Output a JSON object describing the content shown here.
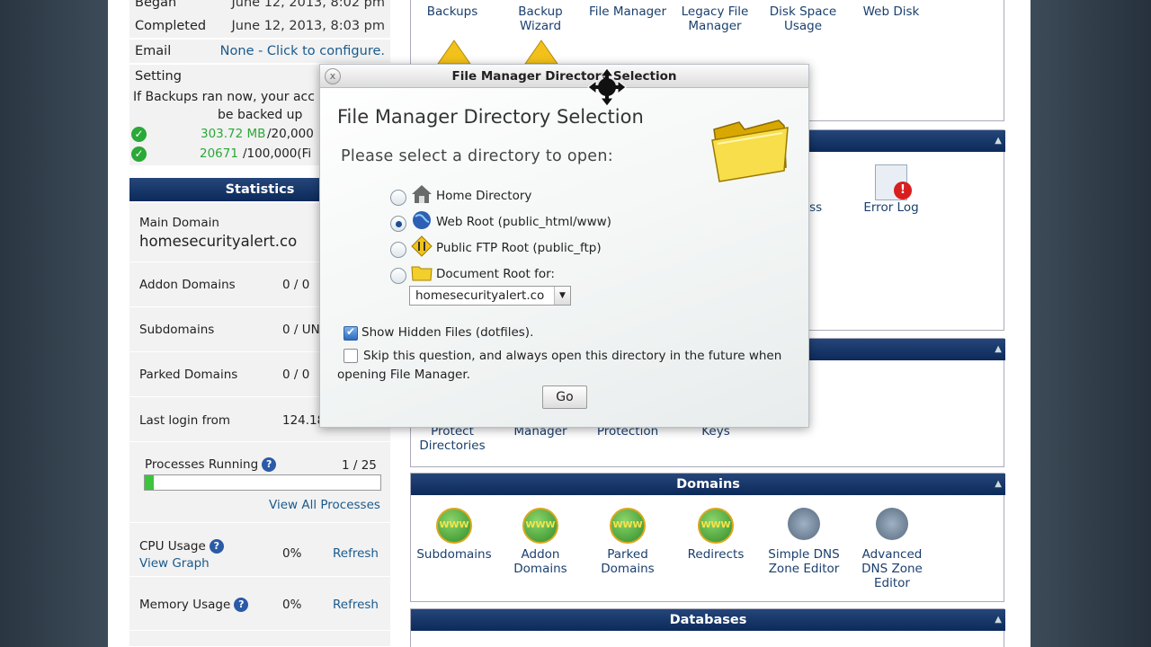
{
  "backup": {
    "began_label": "Began",
    "began_value": "June 12, 2013, 8:02 pm",
    "completed_label": "Completed",
    "completed_value": "June 12, 2013, 8:03 pm",
    "email_label": "Email",
    "email_value": "None - Click to configure.",
    "setting_label": "Setting",
    "message_line1": "If Backups ran now, your acc",
    "message_line2": "be backed up",
    "size_value": "303.72 MB",
    "size_limit": "/20,000",
    "files_value": "20671",
    "files_limit": "/100,000(Fi"
  },
  "stats": {
    "title": "Statistics",
    "main_domain_label": "Main Domain",
    "main_domain_value": "homesecurityalert.co",
    "addon_label": "Addon Domains",
    "addon_value": "0 / 0",
    "sub_label": "Subdomains",
    "sub_value": "0 / UN",
    "parked_label": "Parked Domains",
    "parked_value": "0 / 0",
    "login_label": "Last login from",
    "login_value": "124.18",
    "proc_label": "Processes Running",
    "proc_value": "1 / 25",
    "proc_fraction": 0.04,
    "view_all": "View All Processes",
    "cpu_label": "CPU Usage",
    "cpu_graph": "View Graph",
    "cpu_value": "0%",
    "cpu_refresh": "Refresh",
    "mem_label": "Memory Usage",
    "mem_value": "0%",
    "mem_refresh": "Refresh"
  },
  "files_section": {
    "items": [
      "Backups",
      "Backup Wizard",
      "File Manager",
      "Legacy File Manager",
      "Disk Space Usage",
      "Web Disk"
    ]
  },
  "logs_section": {
    "partial_item": "ccess\ns",
    "error_log": "Error Log"
  },
  "security_section": {
    "items": [
      "Protect Directories",
      "Manager",
      "Protection",
      "Keys"
    ]
  },
  "domains_section": {
    "title": "Domains",
    "items": [
      "Subdomains",
      "Addon Domains",
      "Parked Domains",
      "Redirects",
      "Simple DNS Zone Editor",
      "Advanced DNS Zone Editor"
    ]
  },
  "databases_section": {
    "title": "Databases"
  },
  "dialog": {
    "title": "File Manager Directory Selection",
    "close": "x",
    "heading": "File Manager Directory Selection",
    "prompt": "Please select a directory to open:",
    "options": [
      "Home Directory",
      "Web Root (public_html/www)",
      "Public FTP Root (public_ftp)",
      "Document Root for:"
    ],
    "selected_option": "Web Root (public_html/www)",
    "domain_select": "homesecurityalert.co",
    "show_hidden": "Show Hidden Files (dotfiles).",
    "skip_line1": "Skip this question, and always open this directory in the future when",
    "skip_line2": "opening File Manager.",
    "go": "Go"
  },
  "colors": {
    "header_blue": "#0c2a5a",
    "link_blue": "#1a5a8c",
    "ok_green": "#2aa838"
  }
}
